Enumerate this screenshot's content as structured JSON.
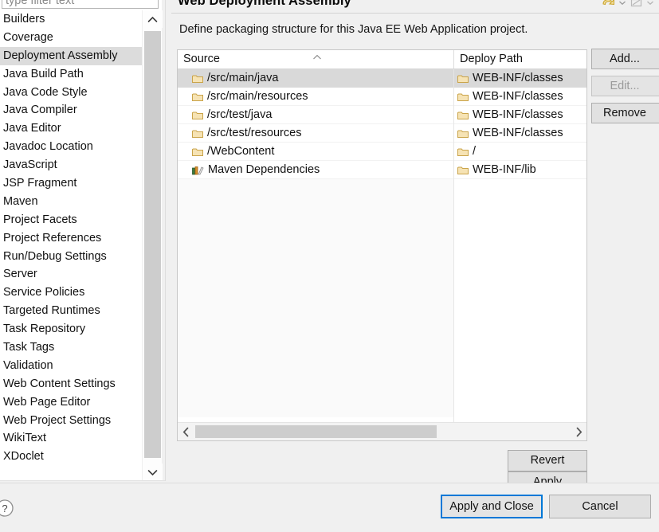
{
  "sidebar": {
    "filter": {
      "value": "",
      "placeholder": "type filter text"
    },
    "items": [
      {
        "label": "Builders",
        "selected": false
      },
      {
        "label": "Coverage",
        "selected": false
      },
      {
        "label": "Deployment Assembly",
        "selected": true
      },
      {
        "label": "Java Build Path",
        "selected": false
      },
      {
        "label": "Java Code Style",
        "selected": false
      },
      {
        "label": "Java Compiler",
        "selected": false
      },
      {
        "label": "Java Editor",
        "selected": false
      },
      {
        "label": "Javadoc Location",
        "selected": false
      },
      {
        "label": "JavaScript",
        "selected": false
      },
      {
        "label": "JSP Fragment",
        "selected": false
      },
      {
        "label": "Maven",
        "selected": false
      },
      {
        "label": "Project Facets",
        "selected": false
      },
      {
        "label": "Project References",
        "selected": false
      },
      {
        "label": "Run/Debug Settings",
        "selected": false
      },
      {
        "label": "Server",
        "selected": false
      },
      {
        "label": "Service Policies",
        "selected": false
      },
      {
        "label": "Targeted Runtimes",
        "selected": false
      },
      {
        "label": "Task Repository",
        "selected": false
      },
      {
        "label": "Task Tags",
        "selected": false
      },
      {
        "label": "Validation",
        "selected": false
      },
      {
        "label": "Web Content Settings",
        "selected": false
      },
      {
        "label": "Web Page Editor",
        "selected": false
      },
      {
        "label": "Web Project Settings",
        "selected": false
      },
      {
        "label": "WikiText",
        "selected": false
      },
      {
        "label": "XDoclet",
        "selected": false
      }
    ]
  },
  "page": {
    "title": "Web Deployment Assembly",
    "description": "Define packaging structure for this Java EE Web Application project."
  },
  "table": {
    "columns": [
      "Source",
      "Deploy Path"
    ],
    "sort_column": "Source",
    "sort_direction": "ascending",
    "rows": [
      {
        "source": "/src/main/java",
        "deploy": "WEB-INF/classes",
        "icon": "folder-icon",
        "selected": true
      },
      {
        "source": "/src/main/resources",
        "deploy": "WEB-INF/classes",
        "icon": "folder-icon",
        "selected": false
      },
      {
        "source": "/src/test/java",
        "deploy": "WEB-INF/classes",
        "icon": "folder-icon",
        "selected": false
      },
      {
        "source": "/src/test/resources",
        "deploy": "WEB-INF/classes",
        "icon": "folder-icon",
        "selected": false
      },
      {
        "source": "/WebContent",
        "deploy": "/",
        "icon": "folder-icon",
        "selected": false
      },
      {
        "source": "Maven Dependencies",
        "deploy": "WEB-INF/lib",
        "icon": "library-icon",
        "selected": false
      }
    ],
    "empty_row_count": 13
  },
  "side_buttons": [
    {
      "label": "Add...",
      "enabled": true
    },
    {
      "label": "Edit...",
      "enabled": false
    },
    {
      "label": "Remove",
      "enabled": true
    }
  ],
  "apply_buttons": [
    {
      "label": "Revert"
    },
    {
      "label": "Apply"
    }
  ],
  "dialog_buttons": [
    {
      "label": "Apply and Close",
      "default": true
    },
    {
      "label": "Cancel",
      "default": false
    }
  ],
  "icons": {
    "help": "help-icon",
    "restore_defaults": "restore-defaults-icon",
    "apply_template": "apply-template-icon",
    "scroll_up": "chevron-up-icon",
    "scroll_down": "chevron-down-icon",
    "scroll_left": "chevron-left-icon",
    "scroll_right": "chevron-right-icon"
  },
  "colors": {
    "accent": "#0078d7",
    "selection": "#d9d9d9",
    "folder": "#f0d49a",
    "panel": "#f0f0f0",
    "button_face": "#e1e1e1"
  }
}
